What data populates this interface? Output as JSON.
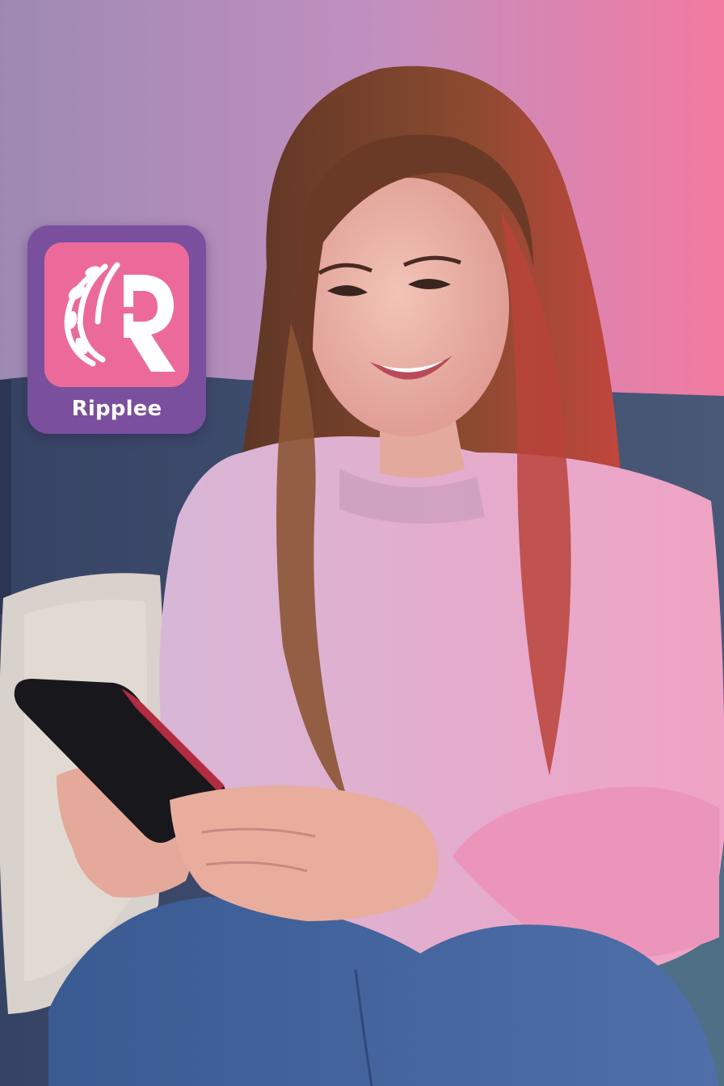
{
  "photo": {
    "colors": {
      "wall_left": "#a58fb8",
      "wall_right": "#f07aa2",
      "sofa": "#3e4c68",
      "sweater": "#e6a9c8",
      "hair": "#6b3a24",
      "skin": "#eab3a3",
      "jeans": "#3f5f95",
      "phone": "#17171c",
      "pillow": "#d8d0ca"
    }
  },
  "app_badge": {
    "name": "Ripplee",
    "icon": "ripplee-logo-icon",
    "colors": {
      "frame": "#7a4f9e",
      "tile": "#ec6a9a",
      "glyph": "#ffffff"
    }
  }
}
